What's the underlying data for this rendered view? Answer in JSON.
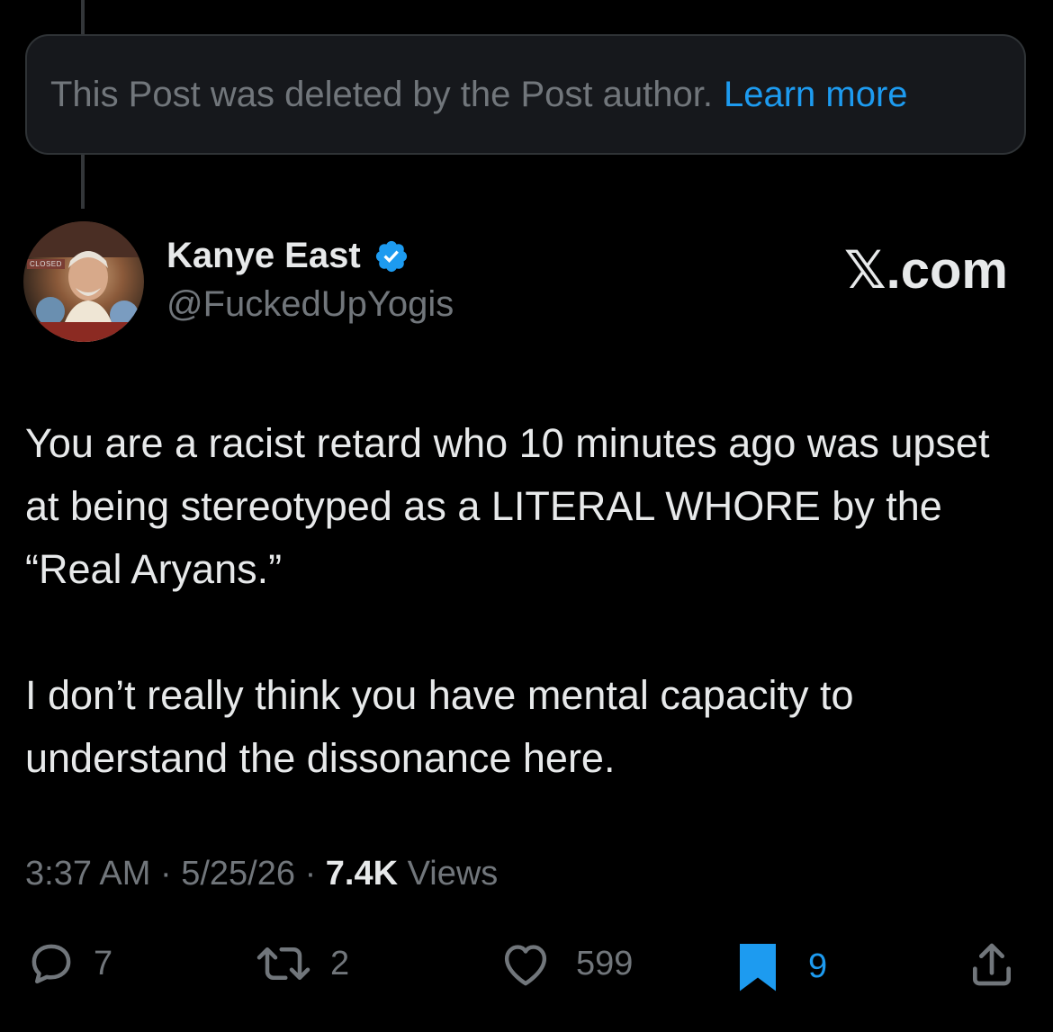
{
  "deleted_notice": {
    "text": "This Post was deleted by the Post author.",
    "link": "Learn more",
    "link_color": "#1d9bf0"
  },
  "author": {
    "display_name": "Kanye East",
    "handle": "@FuckedUpYogis",
    "verified": true,
    "avatar_sign_text": "CLOSED"
  },
  "watermark": "𝕏.com",
  "post": {
    "paragraphs": [
      "You are a racist retard who 10 minutes ago was upset at being stereotyped as a LITERAL WHORE by the “Real Aryans.”",
      "I don’t really think you have mental capacity to understand the dissonance here."
    ]
  },
  "meta": {
    "time": "3:37 AM",
    "separator": "·",
    "date": "5/25/26",
    "views_count": "7.4K",
    "views_label": "Views"
  },
  "actions": {
    "replies": "7",
    "reposts": "2",
    "likes": "599",
    "bookmarks": "9",
    "bookmarked": true
  },
  "colors": {
    "background": "#000000",
    "text": "#e7e9ea",
    "secondary": "#71767b",
    "accent": "#1d9bf0"
  }
}
